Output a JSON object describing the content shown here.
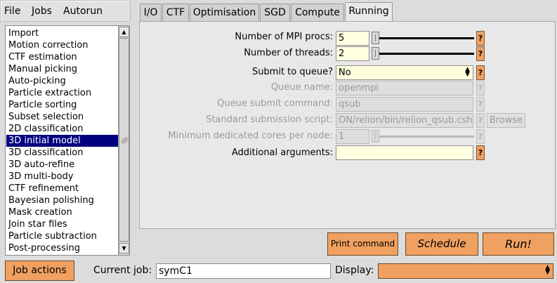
{
  "menubar": {
    "file": "File",
    "jobs": "Jobs",
    "autorun": "Autorun"
  },
  "processes": [
    "Import",
    "Motion correction",
    "CTF estimation",
    "Manual picking",
    "Auto-picking",
    "Particle extraction",
    "Particle sorting",
    "Subset selection",
    "2D classification",
    "3D initial model",
    "3D classification",
    "3D auto-refine",
    "3D multi-body",
    "CTF refinement",
    "Bayesian polishing",
    "Mask creation",
    "Join star files",
    "Particle subtraction",
    "Post-processing"
  ],
  "selected_process_index": 9,
  "tabs": [
    "I/O",
    "CTF",
    "Optimisation",
    "SGD",
    "Compute",
    "Running"
  ],
  "active_tab": "Running",
  "form": {
    "mpi_label": "Number of MPI procs:",
    "mpi_value": "5",
    "mpi_slider_fraction": 0.0,
    "threads_label": "Number of threads:",
    "threads_value": "2",
    "threads_slider_fraction": 0.0,
    "queue_label": "Submit to queue?",
    "queue_value": "No",
    "queue_name_label": "Queue name:",
    "queue_name_value": "openmpi",
    "queue_cmd_label": "Queue submit command:",
    "queue_cmd_value": "qsub",
    "script_label": "Standard submission script:",
    "script_value": "ON/relion/bin/relion_qsub.csh",
    "browse_label": "Browse",
    "mincores_label": "Minimum dedicated cores per node:",
    "mincores_value": "1",
    "mincores_slider_fraction": 0.0,
    "args_label": "Additional arguments:",
    "args_value": "",
    "help": "?"
  },
  "buttons": {
    "print": "Print command",
    "schedule": "Schedule",
    "run": "Run!"
  },
  "bottom": {
    "job_actions": "Job actions",
    "current_job_label": "Current job:",
    "current_job_value": "symC1",
    "display_label": "Display:",
    "display_value": ""
  },
  "colors": {
    "accent": "#f0a060",
    "input_bg": "#ffffe0",
    "selection": "#000080"
  }
}
